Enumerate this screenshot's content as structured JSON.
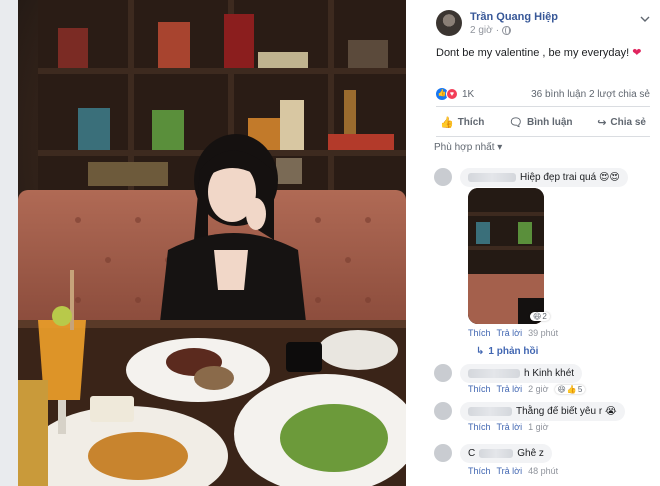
{
  "post": {
    "author": "Trần Quang Hiệp",
    "time": "2 giờ",
    "caption": "Dont be my valentine , be my everyday!",
    "caption_emoji": "❤"
  },
  "stats": {
    "reactions": "1K",
    "comments": "36 bình luận",
    "shares": "2 lượt chia sẻ"
  },
  "actions": {
    "like": "Thích",
    "comment": "Bình luận",
    "share": "Chia sẻ"
  },
  "sort_label": "Phù hợp nhất",
  "comments": [
    {
      "text": "Hiệp đẹp trai quá 😍😍",
      "like": "Thích",
      "reply": "Trả lời",
      "time": "39 phút",
      "reaction_count": "2",
      "replies": "1 phản hồi"
    },
    {
      "text": "h Kinh khét",
      "like": "Thích",
      "reply": "Trả lời",
      "time": "2 giờ",
      "reaction_count": "5"
    },
    {
      "text": "Thằng đế biết yêu r 😭",
      "like": "Thích",
      "reply": "Trả lời",
      "time": "1 giờ"
    },
    {
      "text": "Ghê z",
      "author_partial": "C",
      "like": "Thích",
      "reply": "Trả lời",
      "time": "48 phút"
    }
  ],
  "icons": {
    "globe": "globe-icon",
    "like_reaction": "like-reaction-icon",
    "love_reaction": "love-reaction-icon",
    "like_action": "thumbs-up-icon",
    "comment_action": "speech-bubble-icon",
    "share_action": "share-arrow-icon",
    "options": "chevron-down-icon"
  },
  "colors": {
    "link": "#385898",
    "action_text": "#606770",
    "like_blue": "#1877f2",
    "love_red": "#f33e58",
    "comment_bg": "#f2f3f5"
  }
}
